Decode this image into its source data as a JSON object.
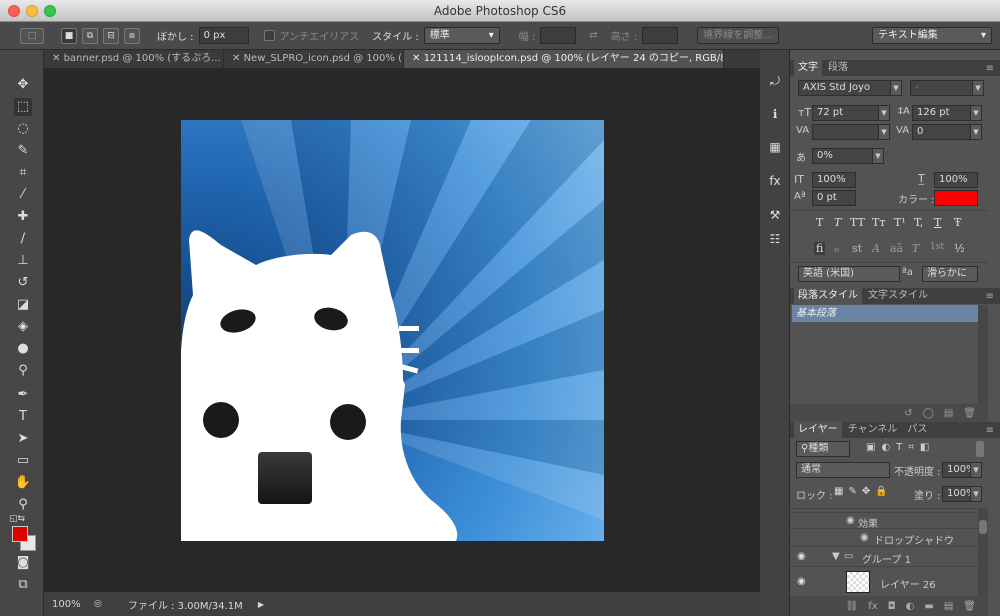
{
  "window": {
    "title": "Adobe Photoshop CS6"
  },
  "options_bar": {
    "feather_label": "ぼかし :",
    "feather_value": "0 px",
    "antialias_label": "アンチエイリアス",
    "style_label": "スタイル :",
    "style_value": "標準",
    "width_label": "幅 :",
    "height_label": "高さ :",
    "refine_edge_button": "境界線を調整...",
    "workspace_value": "テキスト編集"
  },
  "tabs": [
    {
      "label": "banner.psd @ 100% (するぷろ..."
    },
    {
      "label": "New_SLPRO_icon.psd @ 100% (..."
    },
    {
      "label": "121114_isloopIcon.psd @ 100% (レイヤー 24 のコピー, RGB/8)"
    }
  ],
  "status": {
    "zoom": "100%",
    "file_info": "ファイル : 3.00M/34.1M"
  },
  "character_panel": {
    "tabs": [
      "文字",
      "段落"
    ],
    "font_family": "AXIS Std Joyo",
    "font_style": "-",
    "font_size": "72 pt",
    "leading": "126 pt",
    "tracking": "0",
    "tsume": "0%",
    "vertical_scale": "100%",
    "horizontal_scale": "100%",
    "baseline_shift": "0 pt",
    "color_label": "カラー :",
    "text_color": "#ff0000",
    "style_glyphs": [
      "T",
      "T",
      "TT",
      "Tт",
      "T¹",
      "T,",
      "T",
      "Ŧ"
    ],
    "opentype_glyphs": [
      "fi",
      "ℴ",
      "st",
      "A",
      "aā",
      "T",
      "1st",
      "½"
    ],
    "language": "英語 (米国)",
    "antialias": "滑らかに",
    "aa_label": "ªa"
  },
  "paragraph_styles_panel": {
    "tabs": [
      "段落スタイル",
      "文字スタイル"
    ],
    "items": [
      "基本段落"
    ]
  },
  "layers_panel": {
    "tabs": [
      "レイヤー",
      "チャンネル",
      "パス"
    ],
    "filter_kind": "種類",
    "blend_mode": "通常",
    "opacity_label": "不透明度 :",
    "opacity": "100%",
    "lock_label": "ロック :",
    "fill_label": "塗り :",
    "fill": "100%",
    "layers": [
      {
        "name": "効果",
        "indent": 2
      },
      {
        "name": "ドロップシャドウ",
        "indent": 3
      },
      {
        "name": "グループ 1",
        "indent": 1
      },
      {
        "name": "レイヤー 26",
        "indent": 2
      }
    ]
  },
  "colors": {
    "foreground": "#e00000",
    "background": "#e8e8e8",
    "ui_dark": "#282828",
    "artwork_blue": "#3a8fd8"
  }
}
